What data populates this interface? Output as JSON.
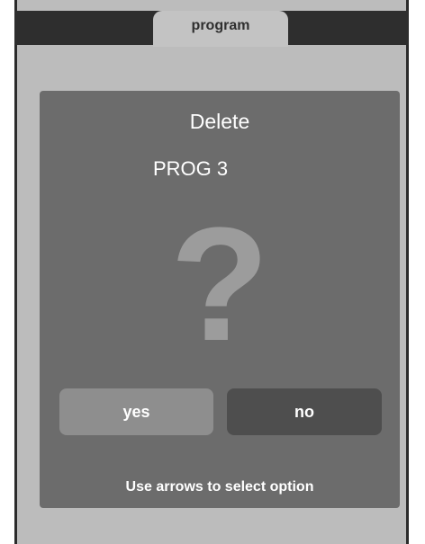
{
  "tab": {
    "label": "program"
  },
  "dialog": {
    "title": "Delete",
    "item_name": "PROG 3",
    "question_mark": "?",
    "buttons": {
      "yes": "yes",
      "no": "no"
    },
    "hint": "Use arrows to select option"
  },
  "colors": {
    "device_body": "#bcbcbc",
    "top_bar": "#2e2e2e",
    "dialog_bg": "#6c6c6c",
    "question_mark": "#9c9c9c",
    "yes_button_selected": "#8e8e8e",
    "no_button": "#4e4e4e"
  }
}
